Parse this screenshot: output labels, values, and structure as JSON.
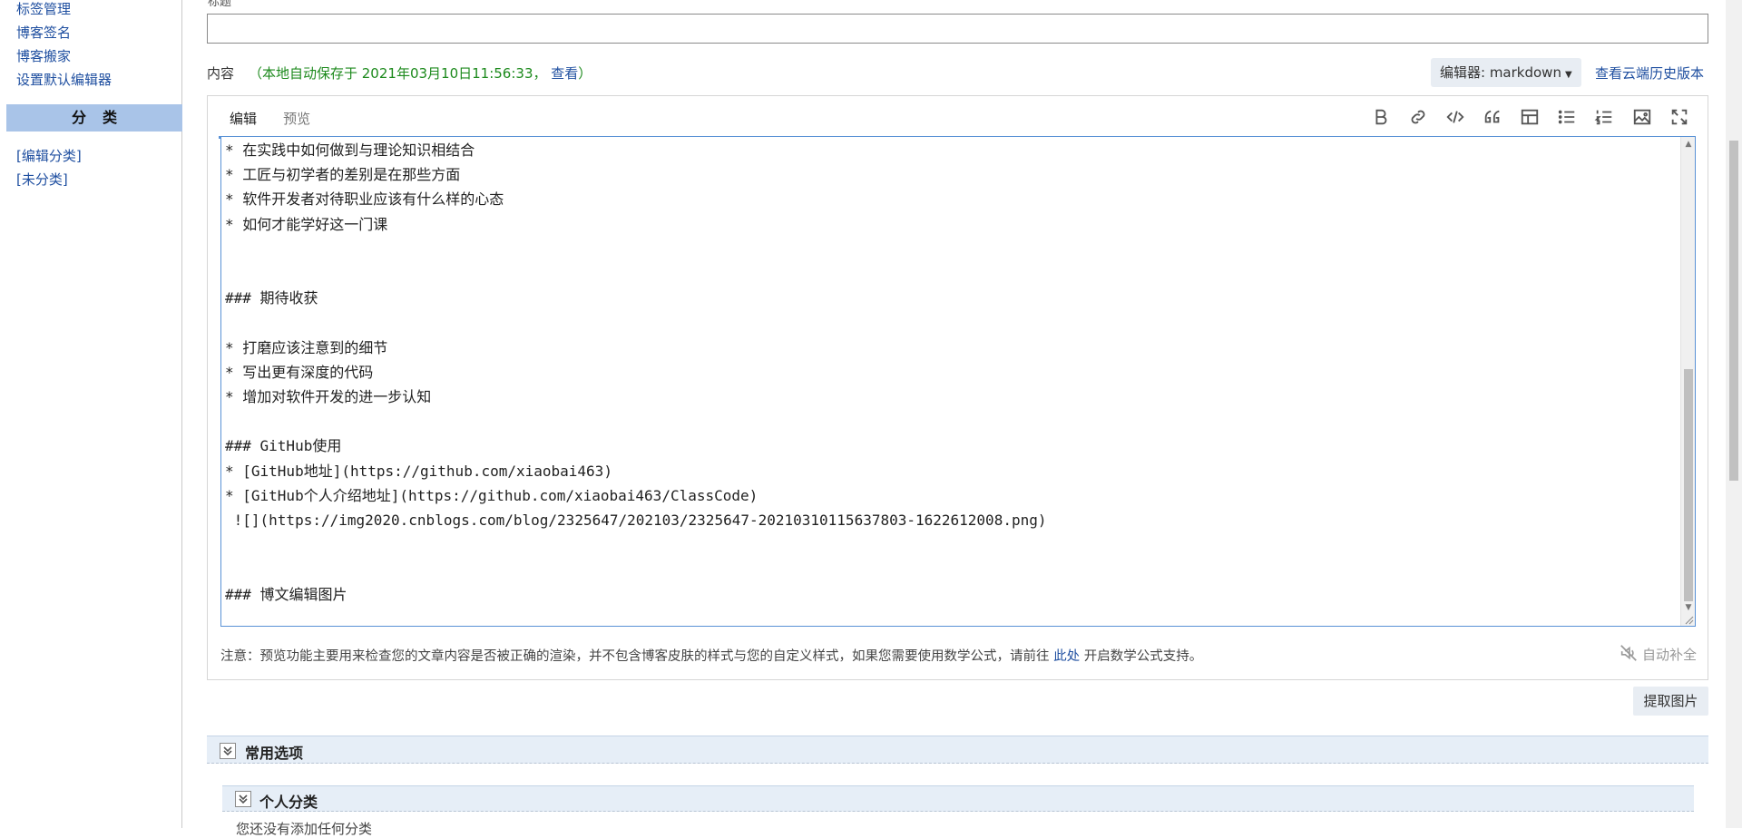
{
  "sidebar": {
    "links": [
      "标签管理",
      "博客签名",
      "博客搬家",
      "设置默认编辑器"
    ],
    "category_header": "分类",
    "category_links": [
      "[编辑分类]",
      "[未分类]"
    ]
  },
  "form": {
    "title_label": "标题",
    "title_value": "",
    "content_label": "内容",
    "autosave_text": "（本地自动保存于 2021年03月10日11:56:33，",
    "autosave_view": "查看",
    "autosave_close": "）",
    "editor_select": "编辑器: markdown",
    "history_link": "查看云端历史版本"
  },
  "editor": {
    "tabs": [
      "编辑",
      "预览"
    ],
    "active_tab": "编辑",
    "toolbar_icons": [
      "bold-icon",
      "link-icon",
      "code-icon",
      "quote-icon",
      "table-icon",
      "bullet-list-icon",
      "numbered-list-icon",
      "image-icon",
      "fullscreen-icon"
    ],
    "content": "* 在实践中如何做到与理论知识相结合\n* 工匠与初学者的差别是在那些方面\n* 软件开发者对待职业应该有什么样的心态\n* 如何才能学好这一门课\n\n\n### 期待收获\n\n* 打磨应该注意到的细节\n* 写出更有深度的代码\n* 增加对软件开发的进一步认知\n\n### GitHub使用\n* [GitHub地址](https://github.com/xiaobai463)\n* [GitHub个人介绍地址](https://github.com/xiaobai463/ClassCode)\n ![](https://img2020.cnblogs.com/blog/2325647/202103/2325647-20210310115637803-1622612008.png)\n\n\n### 博文编辑图片",
    "note_prefix": "注意：预览功能主要用来检查您的文章内容是否被正确的渲染，并不包含博客皮肤的样式与您的自定义样式，如果您需要使用数学公式，请前往 ",
    "note_link": "此处",
    "note_suffix": " 开启数学公式支持。",
    "autocomplete_label": "自动补全"
  },
  "actions": {
    "extract_images": "提取图片"
  },
  "sections": {
    "common_options": "常用选项",
    "personal_category": "个人分类",
    "cut_text": "您还没有添加任何分类"
  },
  "colors": {
    "link": "#1f4fa0",
    "autosave_green": "#1d8a1d",
    "category_header_bg": "#a9c4e8",
    "active_tab_border": "#5a92d6"
  }
}
